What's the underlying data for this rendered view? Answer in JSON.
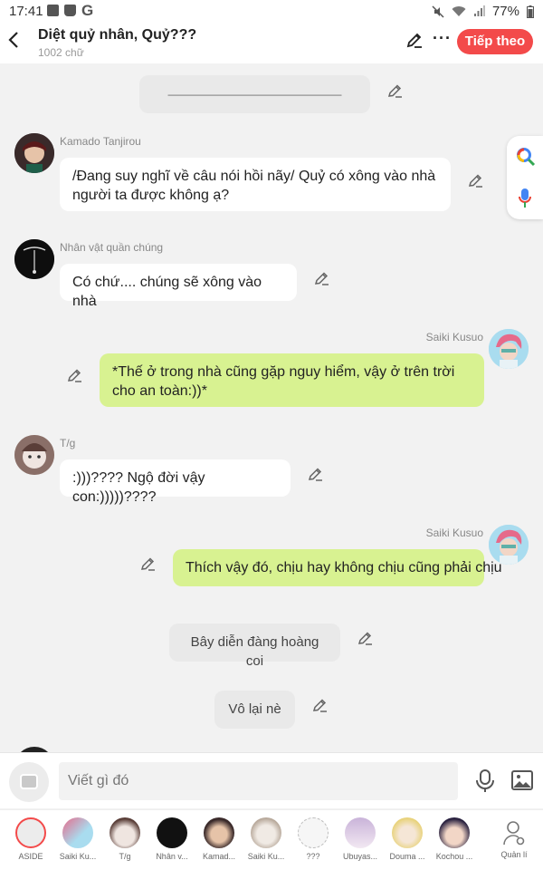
{
  "status": {
    "time": "17:41",
    "battery": "77%"
  },
  "header": {
    "back_icon": "chevron-left-icon",
    "title": "Diệt quỷ nhân, Quỷ???",
    "subtitle": "1002 chữ",
    "next_label": "Tiếp theo",
    "accent": "#f34a4a"
  },
  "chat": {
    "top_divider": "————————————————",
    "messages": [
      {
        "sender": "Kamado Tanjirou",
        "text": "/Đang suy nghĩ về câu nói hồi nãy/ Quỷ có xông vào nhà người ta được không ạ?"
      },
      {
        "sender": "Nhân vật quần chúng",
        "text": "Có chứ.... chúng sẽ xông vào nhà"
      },
      {
        "sender": "Saiki Kusuo",
        "text": "*Thế ở trong nhà cũng gặp nguy hiểm, vậy ở trên trời cho an toàn:))*"
      },
      {
        "sender": "T/g",
        "text": ":)))???? Ngộ đời vậy con:)))))????"
      },
      {
        "sender": "Saiki Kusuo",
        "text": "Thích vậy đó, chịu hay không chịu cũng phải chịu"
      },
      {
        "sender": "",
        "text": "Bây diễn đàng hoàng coi"
      },
      {
        "sender": "",
        "text": "Vô lại nè"
      }
    ]
  },
  "input": {
    "placeholder": "Viết gì đó"
  },
  "characters": [
    {
      "name": "ASIDE"
    },
    {
      "name": "Saiki Ku..."
    },
    {
      "name": "T/g"
    },
    {
      "name": "Nhân v..."
    },
    {
      "name": "Kamad..."
    },
    {
      "name": "Saiki Ku..."
    },
    {
      "name": "???"
    },
    {
      "name": "Ubuyas..."
    },
    {
      "name": "Douma ..."
    },
    {
      "name": "Kochou ..."
    },
    {
      "name": "Quản lí"
    }
  ],
  "colors": {
    "my_bubble": "#d8f291",
    "other_bubble": "#ffffff",
    "narration_bubble": "#e9e9e9"
  }
}
